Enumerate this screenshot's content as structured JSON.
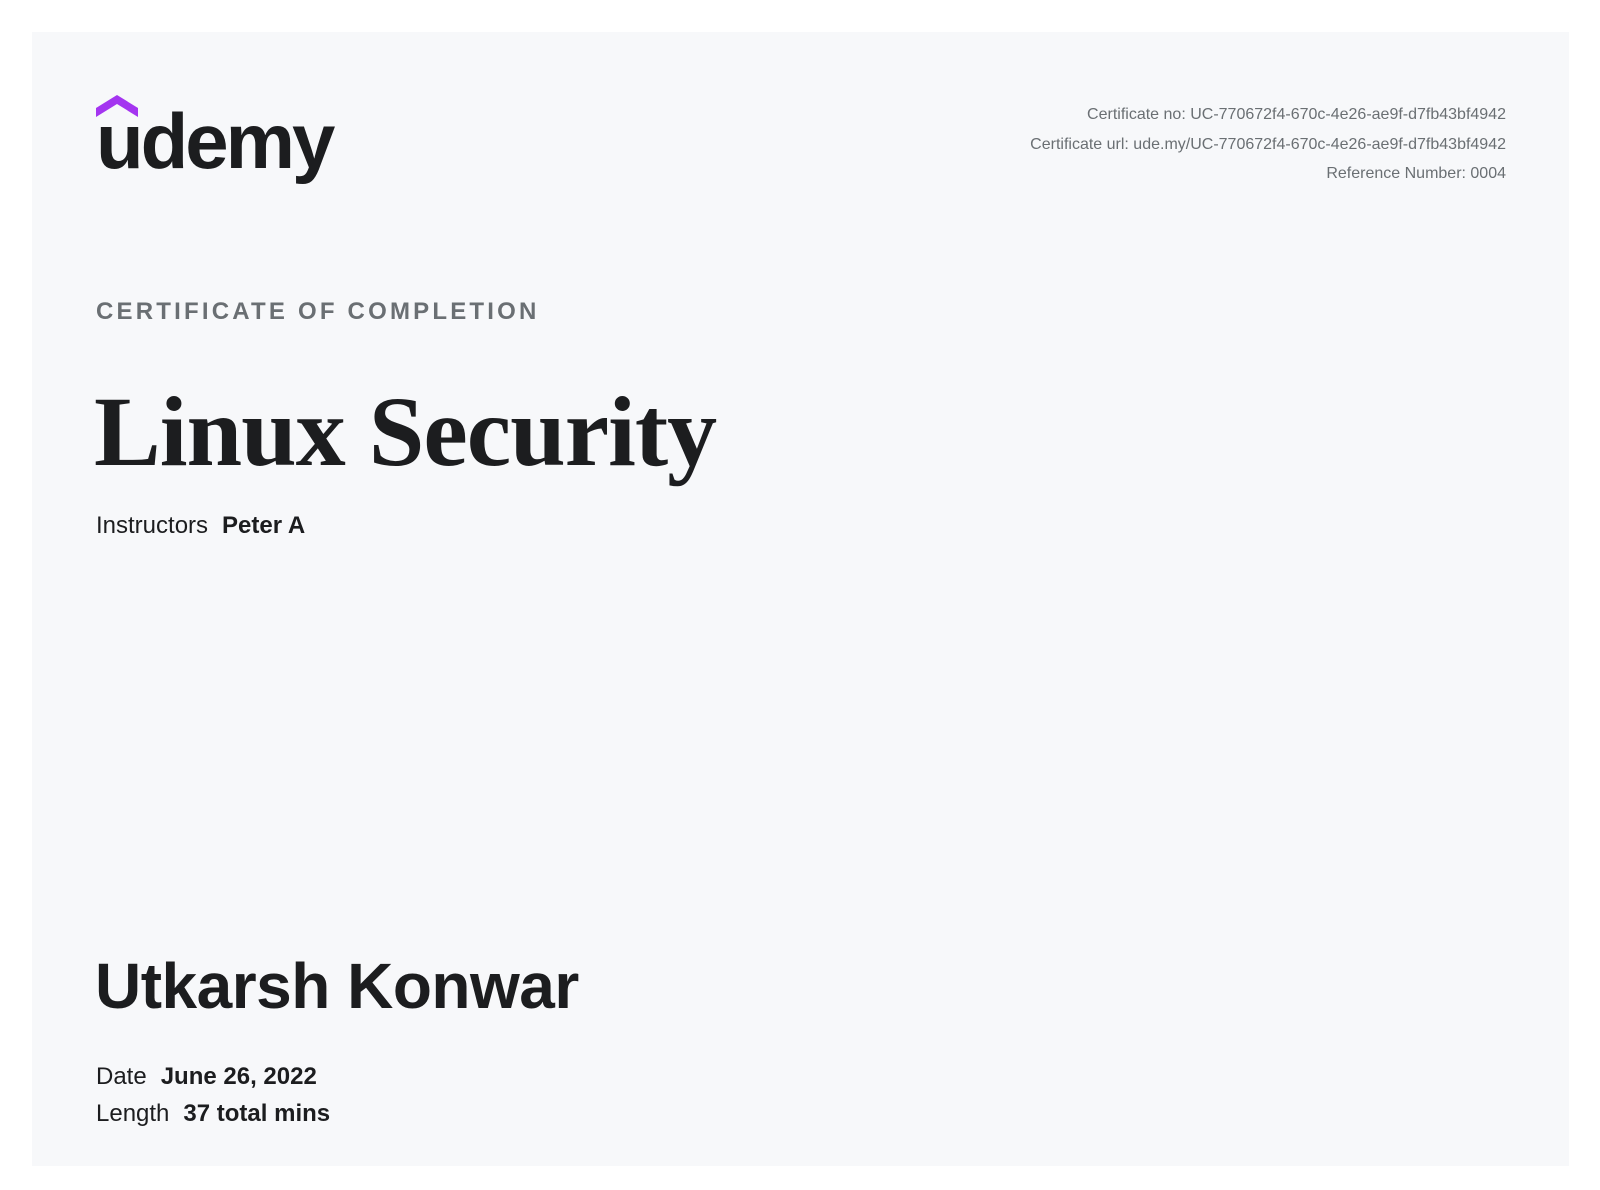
{
  "brand": {
    "name": "udemy",
    "accent_color": "#a435f0",
    "icon": "udemy-chevron-icon"
  },
  "certificate": {
    "number": "Certificate no: UC-770672f4-670c-4e26-ae9f-d7fb43bf4942",
    "url": "Certificate url: ude.my/UC-770672f4-670c-4e26-ae9f-d7fb43bf4942",
    "reference": "Reference Number: 0004",
    "eyebrow": "CERTIFICATE OF COMPLETION",
    "course_title": "Linux Security",
    "instructors_label": "Instructors",
    "instructors_value": "Peter A",
    "recipient": "Utkarsh Konwar",
    "date_label": "Date",
    "date_value": "June 26, 2022",
    "length_label": "Length",
    "length_value": "37 total mins"
  }
}
